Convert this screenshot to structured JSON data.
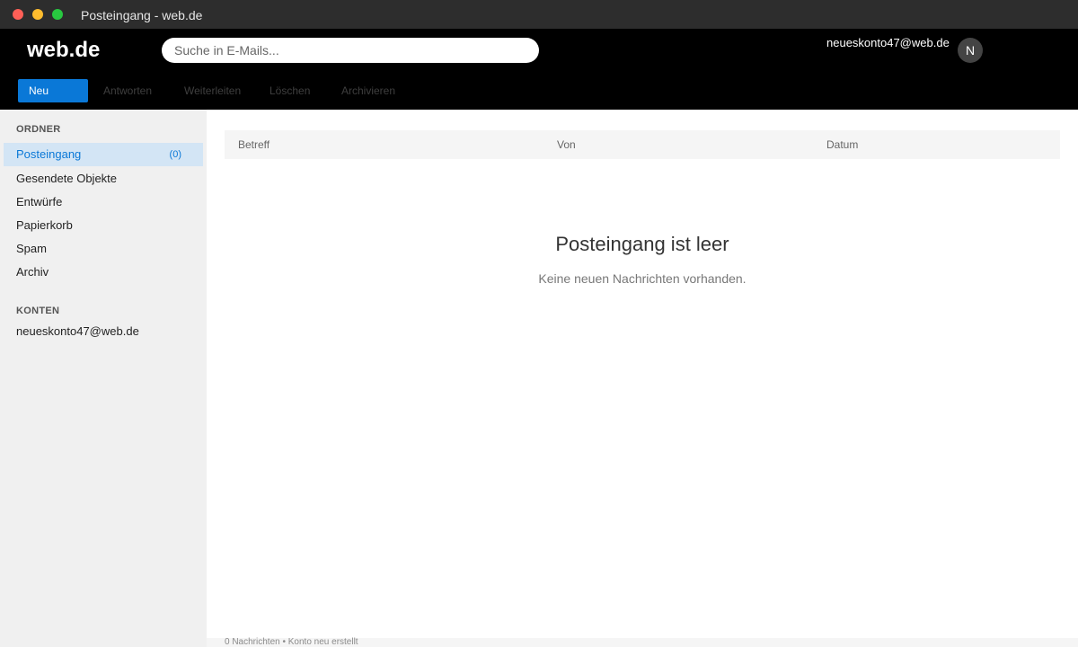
{
  "window": {
    "title": "Posteingang - web.de",
    "traffic_colors": {
      "close": "#ff5f57",
      "minimize": "#febc2e",
      "maximize": "#28c840"
    }
  },
  "header": {
    "logo": "web.de",
    "search_placeholder": "Suche in E-Mails...",
    "user_email": "neueskonto47@web.de",
    "avatar_initial": "N"
  },
  "toolbar": {
    "new_label": "Neu",
    "reply_label": "Antworten",
    "forward_label": "Weiterleiten",
    "delete_label": "Löschen",
    "archive_label": "Archivieren"
  },
  "sidebar": {
    "folders_heading": "ORDNER",
    "folders": [
      {
        "label": "Posteingang",
        "count": "(0)",
        "active": true
      },
      {
        "label": "Gesendete Objekte"
      },
      {
        "label": "Entwürfe"
      },
      {
        "label": "Papierkorb"
      },
      {
        "label": "Spam"
      },
      {
        "label": "Archiv"
      }
    ],
    "accounts_heading": "KONTEN",
    "accounts": [
      {
        "label": "neueskonto47@web.de"
      }
    ]
  },
  "list": {
    "columns": {
      "subject": "Betreff",
      "from": "Von",
      "date": "Datum"
    }
  },
  "empty_state": {
    "title": "Posteingang ist leer",
    "text": "Keine neuen Nachrichten vorhanden."
  },
  "status": {
    "text": "0 Nachrichten • Konto neu erstellt"
  },
  "colors": {
    "accent": "#0a78d7",
    "header_bg": "#000000",
    "active_folder_bg": "#d3e5f5",
    "sidebar_bg": "#f0f0f0"
  }
}
